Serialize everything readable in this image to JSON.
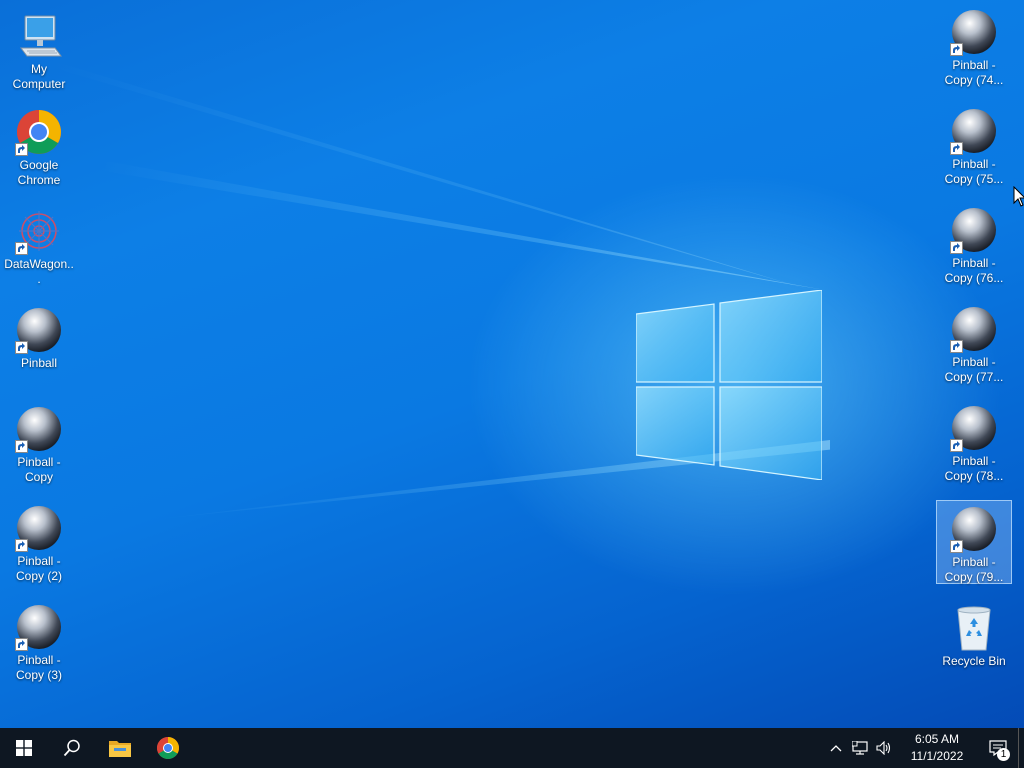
{
  "desktop": {
    "left_icons": [
      {
        "label": "My Computer",
        "icon": "computer-icon",
        "shortcut": false
      },
      {
        "label": "Google Chrome",
        "icon": "chrome-icon",
        "shortcut": true
      },
      {
        "label": "DataWagon...",
        "icon": "datawagon-icon",
        "shortcut": true
      },
      {
        "label": "Pinball",
        "icon": "pinball-icon",
        "shortcut": true
      },
      {
        "label": "Pinball - Copy",
        "icon": "pinball-icon",
        "shortcut": true
      },
      {
        "label": "Pinball - Copy (2)",
        "icon": "pinball-icon",
        "shortcut": true
      },
      {
        "label": "Pinball - Copy (3)",
        "icon": "pinball-icon",
        "shortcut": true
      }
    ],
    "right_icons": [
      {
        "label": "Pinball - Copy (74...",
        "icon": "pinball-icon",
        "shortcut": true
      },
      {
        "label": "Pinball - Copy (75...",
        "icon": "pinball-icon",
        "shortcut": true
      },
      {
        "label": "Pinball - Copy (76...",
        "icon": "pinball-icon",
        "shortcut": true
      },
      {
        "label": "Pinball - Copy (77...",
        "icon": "pinball-icon",
        "shortcut": true
      },
      {
        "label": "Pinball - Copy (78...",
        "icon": "pinball-icon",
        "shortcut": true
      },
      {
        "label": "Pinball - Copy (79...",
        "icon": "pinball-icon",
        "shortcut": true,
        "selected": true
      },
      {
        "label": "Recycle Bin",
        "icon": "recycle-bin-icon",
        "shortcut": false
      }
    ]
  },
  "taskbar": {
    "buttons": [
      "start-icon",
      "search-icon",
      "file-explorer-icon",
      "chrome-icon"
    ],
    "tray": {
      "icons": [
        "chevron-up-icon",
        "network-icon",
        "volume-icon"
      ],
      "time": "6:05 AM",
      "date": "11/1/2022",
      "notification_count": "1"
    }
  },
  "colors": {
    "taskbar_bg": "#0e1722",
    "desktop_accent": "#0a79e2"
  }
}
